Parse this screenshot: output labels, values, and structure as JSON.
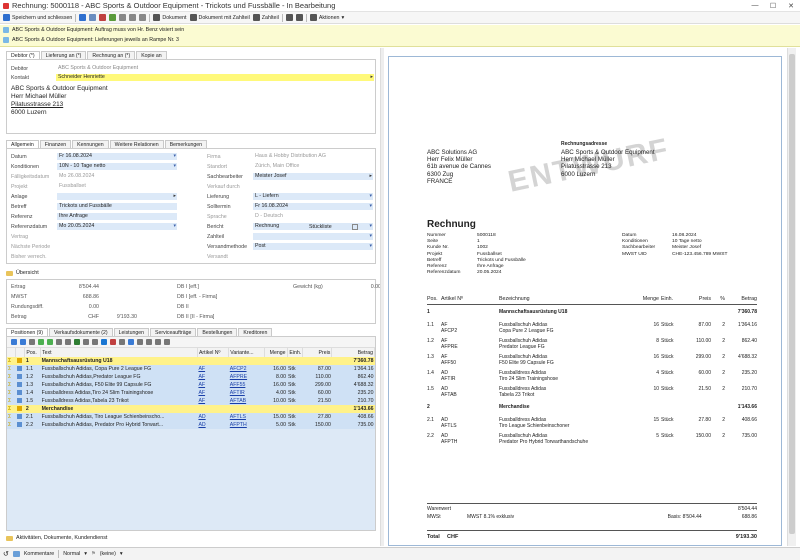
{
  "window": {
    "title": "Rechnung: 5000118 - ABC Sports & Outdoor Equipment - Trickots und Fussbälle - In Bearbeitung",
    "controls": [
      "—",
      "☐",
      "✕"
    ]
  },
  "toolbar": {
    "items": [
      {
        "label": "Speichern und schliessen",
        "icon": "save-close-icon",
        "color": "#2f6fcf"
      },
      {
        "label": "",
        "icon": "save-icon",
        "color": "#2f6fcf"
      },
      {
        "label": "",
        "icon": "copy-icon",
        "color": "#6a8dc0"
      },
      {
        "label": "",
        "icon": "delete-icon",
        "color": "#c04040"
      },
      {
        "label": "",
        "icon": "refresh-icon",
        "color": "#5a9a3a"
      },
      {
        "label": "",
        "icon": "link-icon",
        "color": "#888"
      },
      {
        "label": "",
        "icon": "settings-icon",
        "color": "#888"
      },
      {
        "label": "",
        "icon": "attach-icon",
        "color": "#888"
      },
      {
        "label": "Dokument",
        "icon": "print-icon",
        "color": "#555"
      },
      {
        "label": "Dokument mit Zahlteil",
        "icon": "print-icon",
        "color": "#555"
      },
      {
        "label": "Zahlteil",
        "icon": "print-icon",
        "color": "#555"
      },
      {
        "label": "",
        "icon": "mail-icon",
        "color": "#555"
      },
      {
        "label": "",
        "icon": "view-icon",
        "color": "#555"
      },
      {
        "label": "Aktionen",
        "icon": "actions-icon",
        "color": "#555"
      }
    ]
  },
  "notes": [
    "ABC Sports & Outdoor Equipment: Auftrag muss von Hr. Benz visiert sein",
    "ABC Sports & Outdoor Equipment: Lieferungen jeweils an Rampe Nr. 3"
  ],
  "address_tabs": [
    "Debitor (*)",
    "Lieferung an (*)",
    "Rechnung an (*)",
    "Kopie an"
  ],
  "debitor": {
    "label_debitor": "Debitor",
    "debitor": "ABC Sports & Outdoor Equipment",
    "label_kontakt": "Kontakt",
    "kontakt": "Schneider Henriette",
    "address": [
      "ABC Sports & Outdoor Equipment",
      "Herr Michael Müller",
      "Pilatusstrasse 213",
      "6000 Luzern"
    ]
  },
  "main_tabs": [
    "Allgemein",
    "Finanzen",
    "Kennungen",
    "Weitere Relationen",
    "Bemerkungen"
  ],
  "left_fields": [
    {
      "label": "Datum",
      "value": "Fr 16.08.2024",
      "style": "blue dd"
    },
    {
      "label": "Konditionen",
      "value": "10N - 10 Tage netto",
      "style": "blue dd"
    },
    {
      "label": "Fälligkeitsdatum",
      "value": "Mo 26.08.2024",
      "style": "grey"
    },
    {
      "label": "Projekt",
      "value": "Fussballset",
      "style": "grey"
    },
    {
      "label": "Anlage",
      "value": "",
      "style": "blue dd2"
    },
    {
      "label": "Betreff",
      "value": "Trickots und Fussbälle",
      "style": "blue"
    },
    {
      "label": "Referenz",
      "value": "Ihre Anfrage",
      "style": "blue"
    },
    {
      "label": "Referenzdatum",
      "value": "Mo 20.05.2024",
      "style": "blue dd"
    },
    {
      "label": "Vertrag",
      "value": "",
      "style": "grey"
    },
    {
      "label": "Nächste Periode",
      "value": "",
      "style": "grey"
    },
    {
      "label": "Bisher verrech.",
      "value": "",
      "style": "grey"
    }
  ],
  "right_fields": [
    {
      "label": "Firma",
      "value": "Haus & Hobby Distribution AG",
      "style": "grey"
    },
    {
      "label": "Standort",
      "value": "Zürich, Main Office",
      "style": "grey"
    },
    {
      "label": "Sachbearbeiter",
      "value": "Meister Josef",
      "style": "blue dd2"
    },
    {
      "label": "Verkauf durch",
      "value": "",
      "style": "grey"
    },
    {
      "label": "Lieferung",
      "value": "L - Liefern",
      "style": "blue dd"
    },
    {
      "label": "Solltermin",
      "value": "Fr 16.08.2024",
      "style": "blue dd"
    },
    {
      "label": "Sprache",
      "value": "D - Deutsch",
      "style": "grey"
    },
    {
      "label": "Bericht",
      "value": "Rechnung",
      "style": "blue dd"
    },
    {
      "label": "Zahlteil",
      "value": "",
      "style": "blue dd"
    },
    {
      "label": "Versandmethode",
      "value": "Post",
      "style": "blue dd"
    },
    {
      "label": "Versandt",
      "value": "",
      "style": "grey"
    }
  ],
  "bericht_extra": "Stückliste",
  "overview": {
    "title": "Übersicht",
    "rows": [
      [
        "Ertrag",
        "8'504.44",
        "DB I [eff.]",
        "",
        "Gewicht (kg)",
        "0.00"
      ],
      [
        "MWST",
        "688.86",
        "DB I [eff. - Firma]",
        "",
        "",
        ""
      ],
      [
        "Rundungsdiff.",
        "0.00",
        "DB II",
        "",
        "",
        ""
      ],
      [
        "Betrag",
        "CHF",
        "9'193.30",
        "DB II [II - Firma]",
        "",
        ""
      ]
    ]
  },
  "pos_tabs": [
    "Positionen (9)",
    "Verkaufsdokumente (2)",
    "Leistungen",
    "Serviceaufträge",
    "Bestellungen",
    "Kreditoren"
  ],
  "grid": {
    "headers": [
      "",
      "",
      "Pos.",
      "Text",
      "Artikel Nº",
      "Variante...",
      "Menge",
      "Einh.",
      "Preis",
      "Betrag"
    ],
    "rows": [
      {
        "type": "grp",
        "pos": "1",
        "text": "Mannschaftsausrüstung U18",
        "art": "",
        "var": "",
        "qty": "",
        "unit": "",
        "price": "",
        "amount": "7'360.78"
      },
      {
        "type": "row",
        "pos": "1.1",
        "text": "Fussballschuh Adidas, Copa Pure 2 League FG",
        "art": "AF",
        "var": "AFCP2",
        "qty": "16.00",
        "unit": "Stk",
        "price": "87.00",
        "amount": "1'364.16"
      },
      {
        "type": "row",
        "pos": "1.2",
        "text": "Fussballschuh Adidas,Predator League FG",
        "art": "AF",
        "var": "AFPRE",
        "qty": "8.00",
        "unit": "Stk",
        "price": "110.00",
        "amount": "862.40"
      },
      {
        "type": "row",
        "pos": "1.3",
        "text": "Fussballschuh Adidas, F50 Elite 99 Capsule FG",
        "art": "AF",
        "var": "AFF55",
        "qty": "16.00",
        "unit": "Stk",
        "price": "299.00",
        "amount": "4'688.32"
      },
      {
        "type": "row",
        "pos": "1.4",
        "text": "Fussballdress Adidas,Tiro 24 Slim Trainingshose",
        "art": "AF",
        "var": "AFTIR",
        "qty": "4.00",
        "unit": "Stk",
        "price": "60.00",
        "amount": "235.20"
      },
      {
        "type": "row",
        "pos": "1.5",
        "text": "Fussballdress Adidas,Tabela 23 Trikot",
        "art": "AF",
        "var": "AFTAB",
        "qty": "10.00",
        "unit": "Stk",
        "price": "21.50",
        "amount": "210.70"
      },
      {
        "type": "grp",
        "pos": "2",
        "text": "Merchandise",
        "art": "",
        "var": "",
        "qty": "",
        "unit": "",
        "price": "",
        "amount": "1'143.66"
      },
      {
        "type": "row",
        "pos": "2.1",
        "text": "Fussballschuh Adidas, Tiro League Schienbeinscho...",
        "art": "AD",
        "var": "AFTLS",
        "qty": "15.00",
        "unit": "Stk",
        "price": "27.80",
        "amount": "408.66"
      },
      {
        "type": "row",
        "pos": "2.2",
        "text": "Fussballschuh Adidas, Predator Pro Hybrid Torwart...",
        "art": "AD",
        "var": "AFPTH",
        "qty": "5.00",
        "unit": "Stk",
        "price": "150.00",
        "amount": "735.00"
      }
    ]
  },
  "bottom_section": "Aktivitäten, Dokumente, Kundendienst",
  "statusbar": {
    "kommentare": "Kommentare",
    "mode": "Normal",
    "keine": "(keine)"
  },
  "preview": {
    "sender_small": "Rechnungsadresse",
    "watermark": "ENTWURF",
    "sender": [
      "ABC Solutions AG",
      "Herr Felix Müller",
      "61b avenue de Cannes",
      "6300 Zug",
      "FRANCE"
    ],
    "recipient": [
      "ABC Sports & Outdoor Equipment",
      "Herr Michael Müller",
      "Pilatusstrasse 213",
      "6000 Luzern"
    ],
    "doc_title": "Rechnung",
    "meta_left": [
      [
        "Nummer",
        "5000118"
      ],
      [
        "Seite",
        "1"
      ],
      [
        "Kunde Nr.",
        "1002"
      ],
      [
        "Projekt",
        "Fussballset"
      ],
      [
        "Betreff",
        "Trickots und Fussbälle"
      ],
      [
        "Referenz",
        "Ihre Anfrage"
      ],
      [
        "Referenzdatum",
        "20.05.2024"
      ]
    ],
    "meta_right": [
      [
        "Datum",
        "16.08.2024"
      ],
      [
        "Konditionen",
        "10 Tage netto"
      ],
      [
        "Sachbearbeiter",
        "Meister Josef"
      ],
      [
        "MWST UID",
        "CHE-123.456.789 MWST"
      ]
    ],
    "headers": [
      "Pos.",
      "Artikel Nº",
      "Bezeichnung",
      "Menge",
      "Einh.",
      "Preis",
      "%",
      "Betrag"
    ],
    "lines": [
      {
        "pos": "1",
        "art": "",
        "desc": "Mannschaftsausrüstung U18",
        "desc2": "",
        "qty": "",
        "unit": "",
        "price": "",
        "amount": "7'360.78",
        "bold": true
      },
      {
        "pos": "1.1",
        "art": "AF",
        "art2": "AFCP2",
        "desc": "Fussballschuh Adidas",
        "desc2": "Copa Pure 2 League FG",
        "qty": "16",
        "unit": "Stück",
        "price": "87.00",
        "pct": "2",
        "amount": "1'364.16"
      },
      {
        "pos": "1.2",
        "art": "AF",
        "art2": "AFPRE",
        "desc": "Fussballschuh Adidas",
        "desc2": "Predator League FG",
        "qty": "8",
        "unit": "Stück",
        "price": "110.00",
        "pct": "2",
        "amount": "862.40"
      },
      {
        "pos": "1.3",
        "art": "AF",
        "art2": "AFF50",
        "desc": "Fussballschuh Adidas",
        "desc2": "F50 Elite 99 Capsule FG",
        "qty": "16",
        "unit": "Stück",
        "price": "299.00",
        "pct": "2",
        "amount": "4'688.32"
      },
      {
        "pos": "1.4",
        "art": "AD",
        "art2": "AFTIR",
        "desc": "Fussballdress Adidas",
        "desc2": "Tiro 24 Slim Trainingshose",
        "qty": "4",
        "unit": "Stück",
        "price": "60.00",
        "pct": "2",
        "amount": "235.20"
      },
      {
        "pos": "1.5",
        "art": "AD",
        "art2": "AFTAB",
        "desc": "Fussballdress Adidas",
        "desc2": "Tabela 23 Trikot",
        "qty": "10",
        "unit": "Stück",
        "price": "21.50",
        "pct": "2",
        "amount": "210.70"
      },
      {
        "pos": "2",
        "art": "",
        "desc": "Merchandise",
        "desc2": "",
        "qty": "",
        "unit": "",
        "price": "",
        "amount": "1'143.66",
        "bold": true
      },
      {
        "pos": "2.1",
        "art": "AD",
        "art2": "AFTLS",
        "desc": "Fussballdress Adidas",
        "desc2": "Tiro League Schienbeinschoner",
        "qty": "15",
        "unit": "Stück",
        "price": "27.80",
        "pct": "2",
        "amount": "408.66"
      },
      {
        "pos": "2.2",
        "art": "AD",
        "art2": "AFPTH",
        "desc": "Fussballschuh Adidas",
        "desc2": "Predator Pro Hybrid Torwarthandschuhe",
        "qty": "5",
        "unit": "Stück",
        "price": "150.00",
        "pct": "2",
        "amount": "735.00"
      }
    ],
    "warenwert_label": "Warenwert",
    "warenwert": "8'504.44",
    "mwst_label": "MWSt",
    "mwst_desc": "MWST 8.1% exklusiv",
    "mwst_basis": "Basis: 8'504.44",
    "mwst": "688.86",
    "total_label": "Total",
    "total_cur": "CHF",
    "total": "9'193.30"
  }
}
